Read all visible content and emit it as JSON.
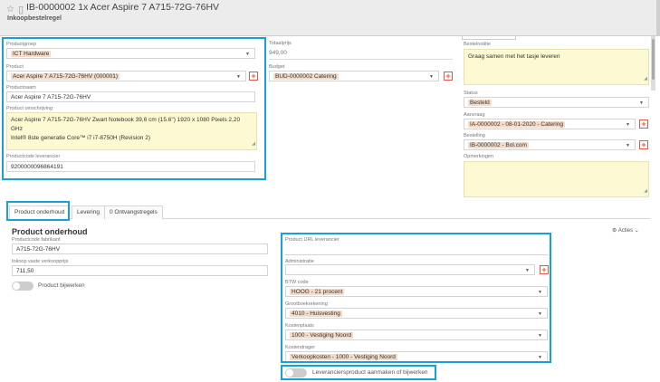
{
  "header": {
    "title": "IB-0000002 1x Acer Aspire 7 A715-72G-76HV",
    "subtitle": "Inkoopbestelregel"
  },
  "left": {
    "productgroep": {
      "label": "Productgroep",
      "value": "ICT Hardware"
    },
    "product": {
      "label": "Product",
      "value": "Acer Aspire 7 A715-72G-76HV (000001)"
    },
    "productnaam": {
      "label": "Productnaam",
      "value": "Acer Aspire 7 A715-72G-76HV"
    },
    "omschrijving": {
      "label": "Product omschrijving",
      "line1": "Acer Aspire 7 A715-72G-76HV Zwart Notebook 39,6 cm (15.6\") 1920 x 1080 Pixels 2,20 GHz",
      "line2": "Intel® 8ste generatie Core™ i7 i7-8750H (Revision 2)"
    },
    "productcode": {
      "label": "Productcode leverancier",
      "value": "9200000096864191"
    }
  },
  "middle": {
    "totaalprijs": {
      "label": "Totaalprijs",
      "value": "949,00"
    },
    "budget": {
      "label": "Budget",
      "value": "BUD-0000002 Catering"
    }
  },
  "right": {
    "bestelnotitie": {
      "label": "Bestelnotitie",
      "value": "Graag samen met het tasje leveren"
    },
    "status": {
      "label": "Status",
      "value": "Besteld"
    },
    "aanvraag": {
      "label": "Aanvraag",
      "value": "IA-0000002 - 08-01-2020 - Catering"
    },
    "bestelling": {
      "label": "Bestelling",
      "value": "IB-0000002 - Bol.com"
    },
    "opmerkingen": {
      "label": "Opmerkingen"
    }
  },
  "tabs": [
    {
      "label": "Product onderhoud"
    },
    {
      "label": "Levering"
    },
    {
      "label": "0  Ontvangstregels"
    }
  ],
  "onderhoud": {
    "title": "Product onderhoud",
    "acties": "Acties",
    "productcode_fabrikant": {
      "label": "Productcode fabrikant",
      "value": "A715-72G-76HV"
    },
    "inkoop_vaste_verkoopprijs": {
      "label": "Inkoop vaste verkoopprijs",
      "value": "711,50"
    },
    "product_bijwerken": "Product bijwerken",
    "product_url": {
      "label": "Product URL leverancier",
      "value": ""
    },
    "administratie": {
      "label": "Administratie",
      "value": ""
    },
    "btw_code": {
      "label": "BTW code",
      "value": "HOOG - 21 procent"
    },
    "grootboekrekening": {
      "label": "Grootboekrekening",
      "value": "4010 - Huisvesting"
    },
    "kostenplaats": {
      "label": "Kostenplaats",
      "value": "1000 - Vestiging Noord"
    },
    "kostendrager": {
      "label": "Kostendrager",
      "value": "Verkoopkosten - 1000 - Vestiging Noord"
    },
    "leveranciersproduct": "Leveranciersproduct aanmaken of bijwerken"
  },
  "colors": {
    "highlight": "#1aa0d8",
    "field_yellow": "#fdf9d3",
    "chip": "#f6dcc8",
    "add": "#e05a4a"
  }
}
